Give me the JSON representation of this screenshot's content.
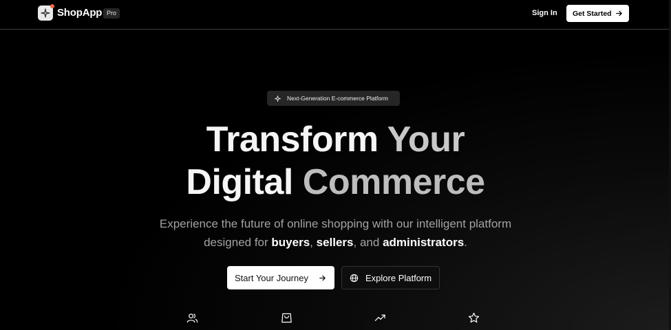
{
  "header": {
    "brand": "ShopApp",
    "badge": "Pro",
    "sign_in": "Sign In",
    "get_started": "Get Started"
  },
  "hero": {
    "pill": "Next-Generation E-commerce Platform",
    "title_line1_a": "Transform",
    "title_line1_b": "Your",
    "title_line2_a": "Digital",
    "title_line2_b": "Commerce",
    "subtitle_pre": "Experience the future of online shopping with our intelligent platform designed for",
    "subtitle_buyers": "buyers",
    "subtitle_comma": ",",
    "subtitle_sellers": "sellers",
    "subtitle_and": ", and",
    "subtitle_admins": "administrators",
    "subtitle_end": ".",
    "primary_cta": "Start Your Journey",
    "secondary_cta": "Explore Platform"
  },
  "features": {
    "icons": [
      "users-icon",
      "shopping-bag-icon",
      "trending-up-icon",
      "star-icon"
    ]
  },
  "colors": {
    "background": "#000000",
    "accent_dot": "#ef6b4a",
    "button_light": "#ffffff"
  }
}
